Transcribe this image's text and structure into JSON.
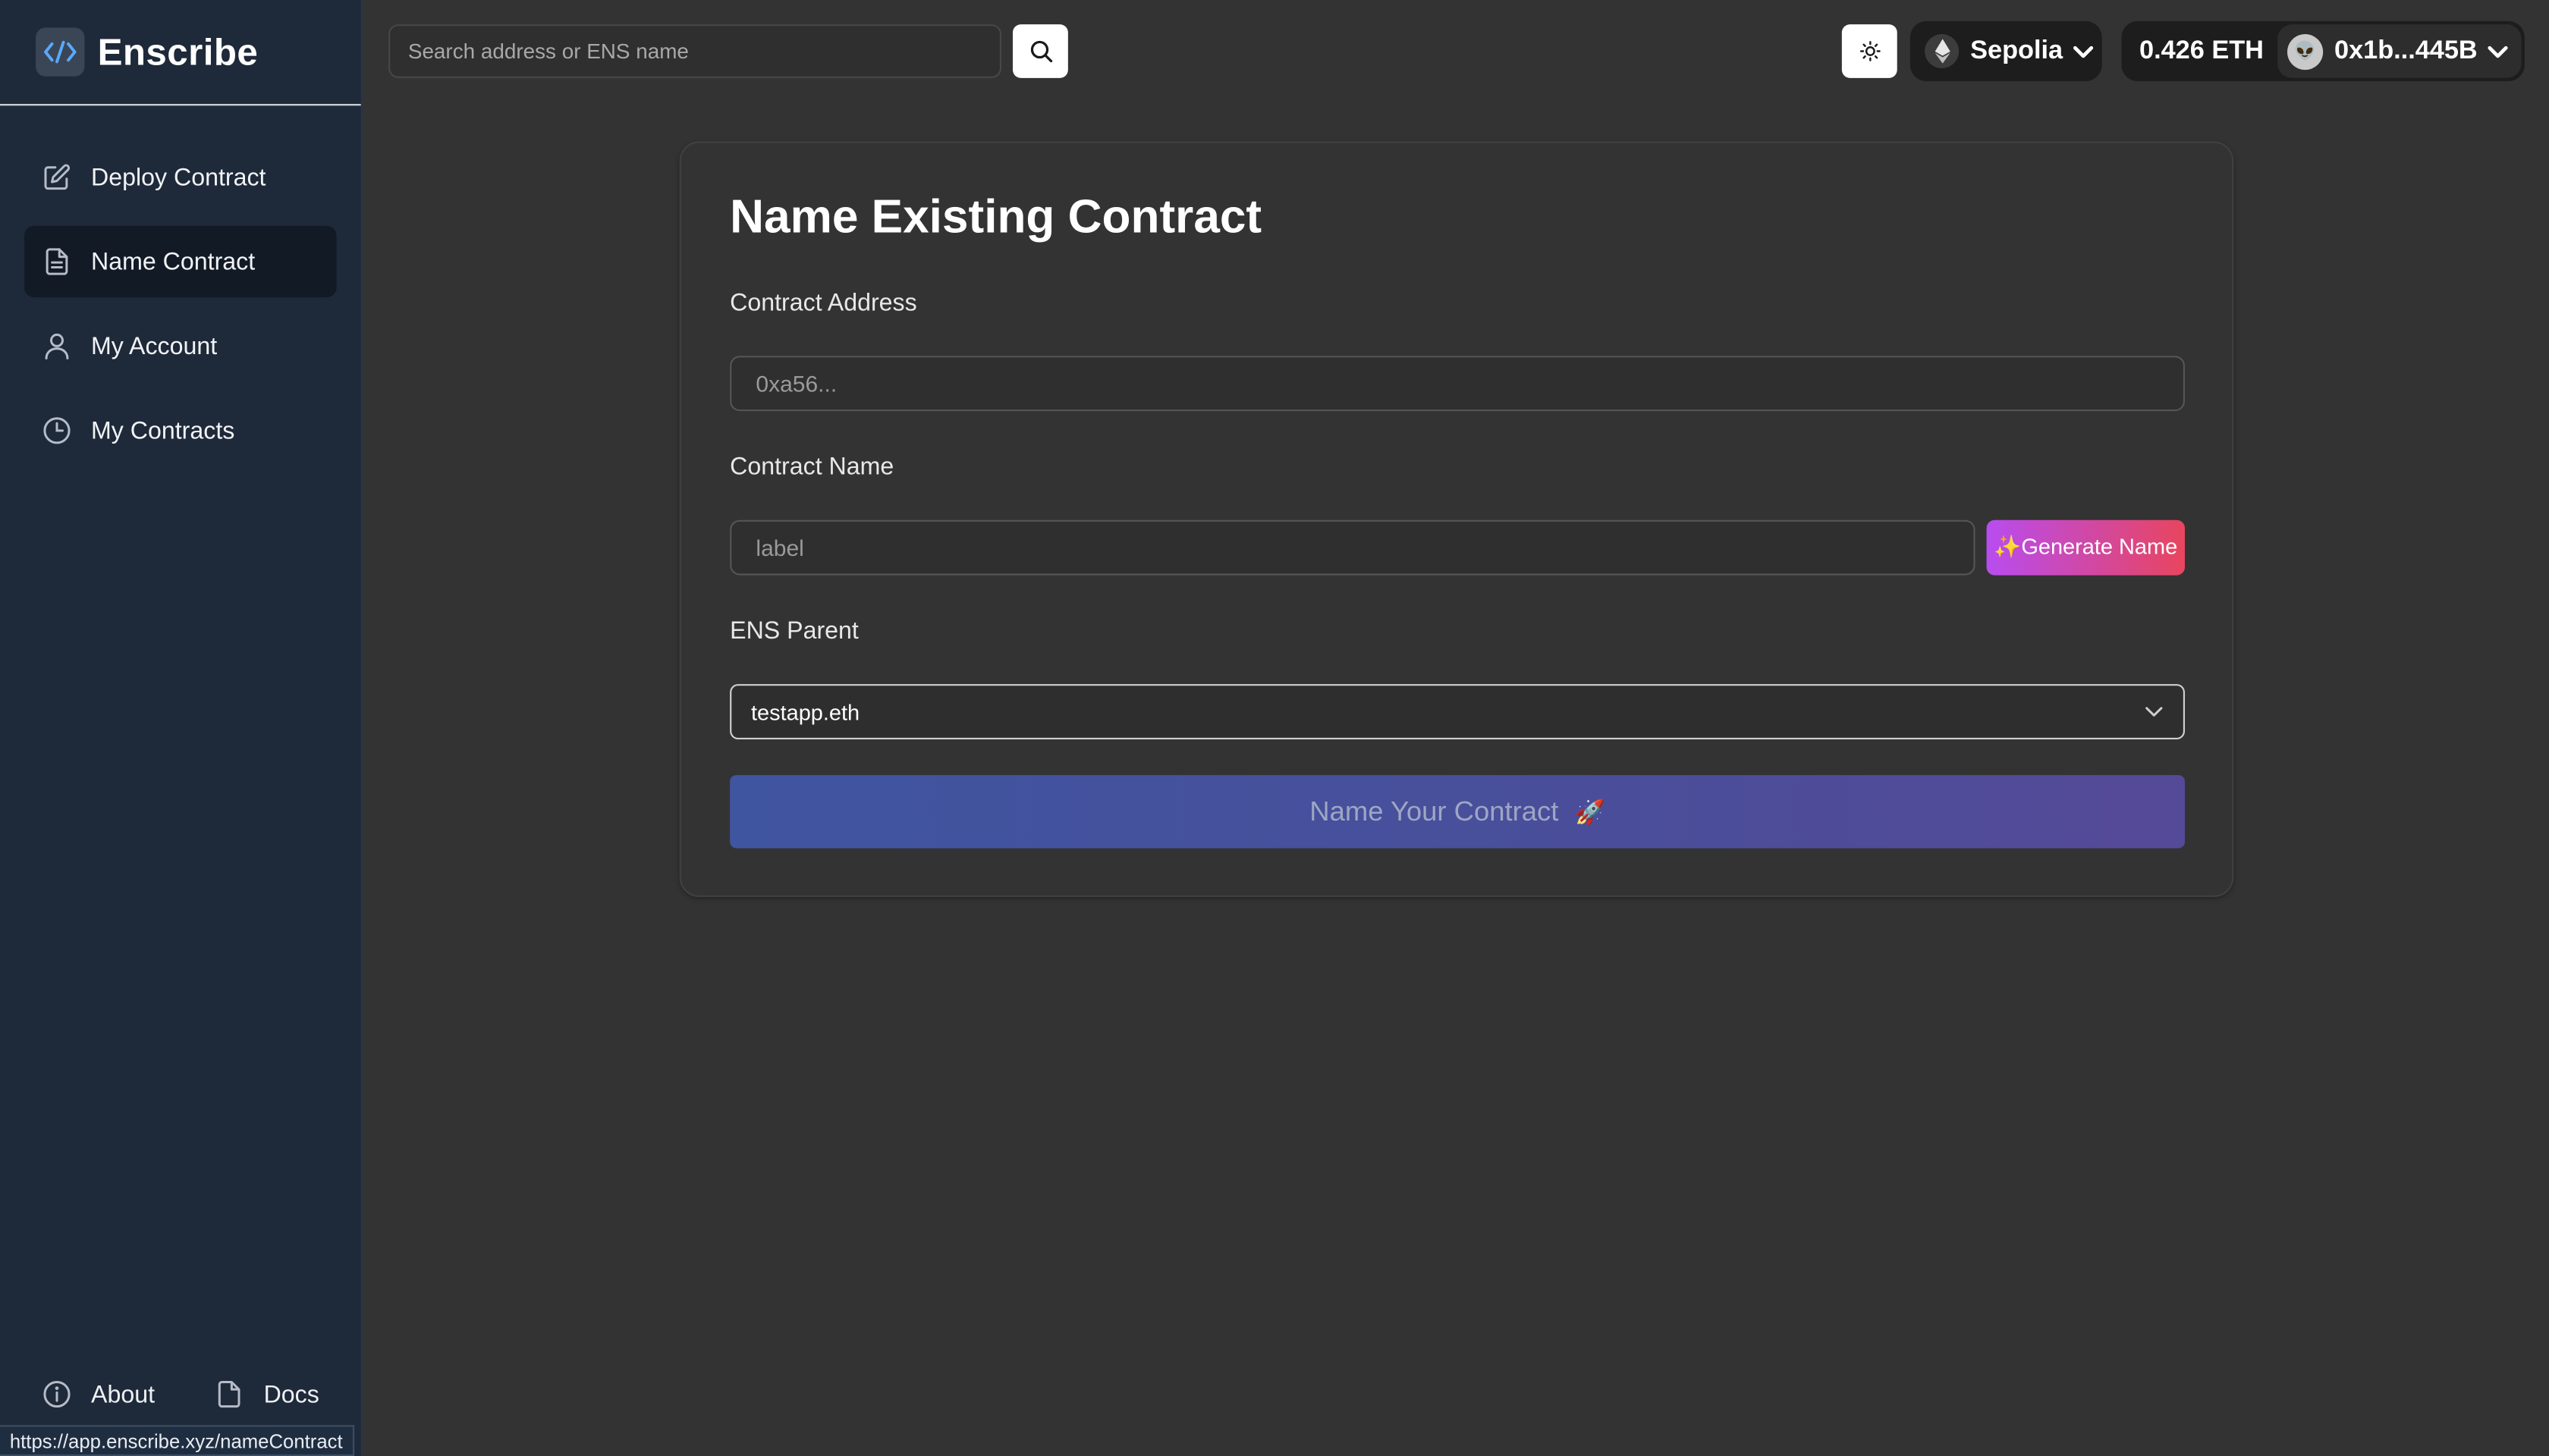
{
  "app": {
    "name": "Enscribe"
  },
  "sidebar": {
    "items": [
      {
        "label": "Deploy Contract",
        "icon": "edit-icon",
        "active": false
      },
      {
        "label": "Name Contract",
        "icon": "document-icon",
        "active": true
      },
      {
        "label": "My Account",
        "icon": "user-icon",
        "active": false
      },
      {
        "label": "My Contracts",
        "icon": "clock-icon",
        "active": false
      }
    ],
    "footer": {
      "about_label": "About",
      "docs_label": "Docs"
    }
  },
  "status_bar": {
    "url": "https://app.enscribe.xyz/nameContract"
  },
  "header": {
    "search_placeholder": "Search address or ENS name",
    "network": "Sepolia",
    "balance": "0.426 ETH",
    "account": "0x1b...445B",
    "avatar_emoji": "👽"
  },
  "form": {
    "title": "Name Existing Contract",
    "contract_address_label": "Contract Address",
    "contract_address_placeholder": "0xa56...",
    "contract_address_value": "",
    "contract_name_label": "Contract Name",
    "contract_name_placeholder": "label",
    "contract_name_value": "",
    "generate_label": "✨Generate Name",
    "ens_parent_label": "ENS Parent",
    "ens_parent_selected": "testapp.eth",
    "submit_label": "Name Your Contract",
    "submit_emoji": "🚀"
  },
  "colors": {
    "background": "#333333",
    "sidebar": "#1e2939",
    "accent_gradient_start": "#b84cf0",
    "accent_gradient_end": "#e8455e",
    "submit_gradient": "#3f55a0"
  }
}
